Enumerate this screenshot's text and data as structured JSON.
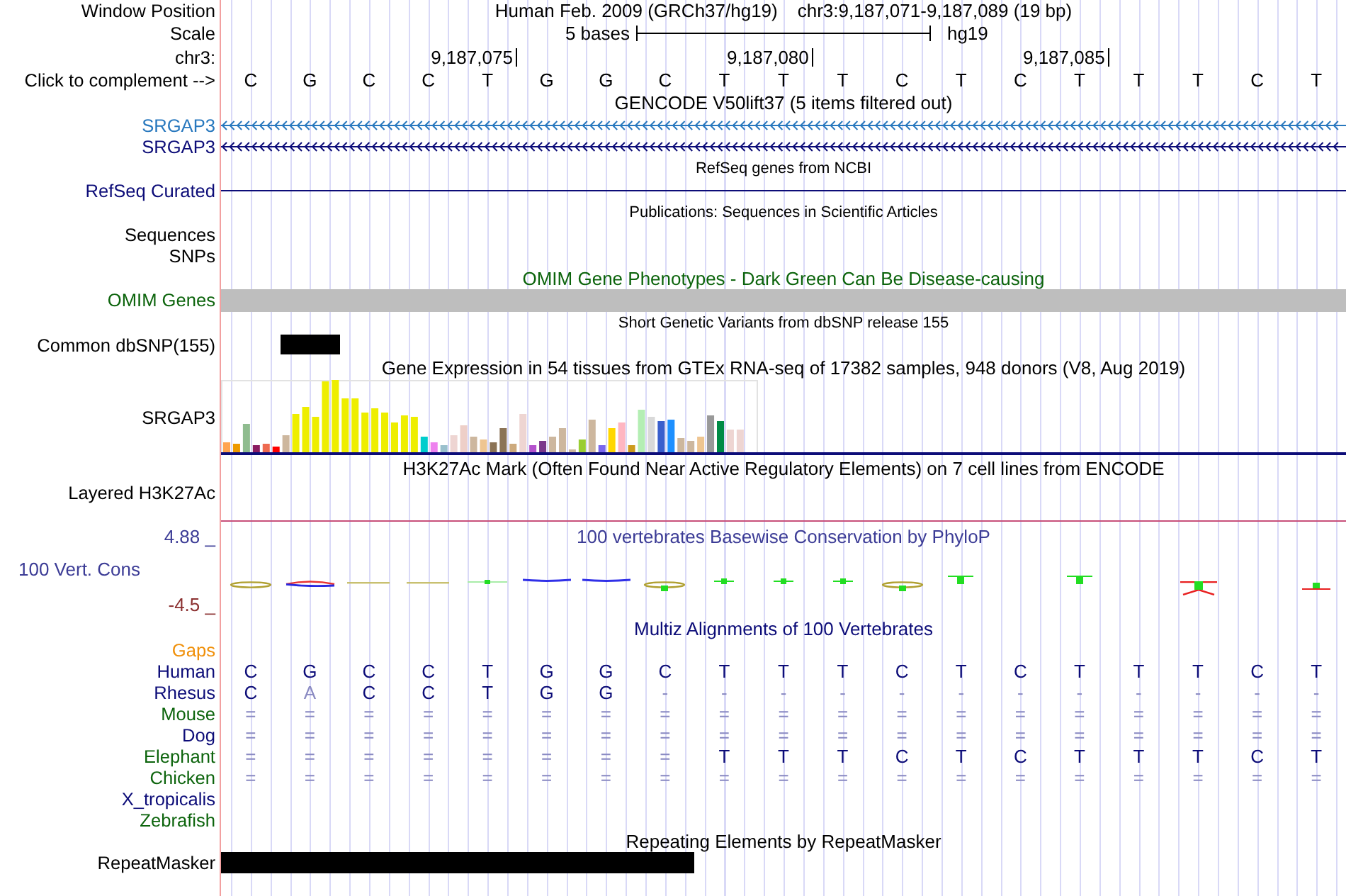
{
  "position": {
    "label": "Window Position",
    "assembly": "Human Feb. 2009 (GRCh37/hg19)",
    "range": "chr3:9,187,071-9,187,089 (19 bp)"
  },
  "scale": {
    "label": "Scale",
    "bar_label": "5 bases",
    "assembly": "hg19"
  },
  "ruler": {
    "label": "chr3:"
  },
  "sequence": {
    "label": "Click to complement -->",
    "bases": [
      {
        "letter": "C"
      },
      {
        "letter": "G"
      },
      {
        "letter": "C"
      },
      {
        "letter": "C"
      },
      {
        "letter": "T",
        "ruler_mark": "9,187,075"
      },
      {
        "letter": "G"
      },
      {
        "letter": "G"
      },
      {
        "letter": "C"
      },
      {
        "letter": "T"
      },
      {
        "letter": "T",
        "ruler_mark": "9,187,080"
      },
      {
        "letter": "T"
      },
      {
        "letter": "C"
      },
      {
        "letter": "T"
      },
      {
        "letter": "C"
      },
      {
        "letter": "T",
        "ruler_mark": "9,187,085"
      },
      {
        "letter": "T"
      },
      {
        "letter": "T"
      },
      {
        "letter": "C"
      },
      {
        "letter": "T"
      }
    ]
  },
  "gencode": {
    "title": "GENCODE V50lift37 (5 items filtered out)",
    "genes": [
      {
        "name": "SRGAP3",
        "color": "#2878be"
      },
      {
        "name": "SRGAP3",
        "color": "#0c0c78"
      }
    ]
  },
  "refseq": {
    "title": "RefSeq genes from NCBI",
    "label": "RefSeq Curated"
  },
  "publications": {
    "title": "Publications: Sequences in Scientific Articles",
    "subtracks": [
      "Sequences",
      "SNPs"
    ]
  },
  "omim": {
    "title": "OMIM Gene Phenotypes - Dark Green Can Be Disease-causing",
    "label": "OMIM Genes"
  },
  "dbsnp": {
    "title": "Short Genetic Variants from dbSNP release 155",
    "label": "Common dbSNP(155)"
  },
  "gtex": {
    "title": "Gene Expression in 54 tissues from GTEx RNA-seq of 17382 samples, 948 donors (V8, Aug 2019)",
    "label": "SRGAP3"
  },
  "h3k27ac": {
    "title": "H3K27Ac Mark (Often Found Near Active Regulatory Elements) on 7 cell lines from ENCODE",
    "label": "Layered H3K27Ac"
  },
  "conservation": {
    "title": "100 vertebrates Basewise Conservation by PhyloP",
    "label": "100 Vert. Cons",
    "scale_max": "4.88 _",
    "scale_min": "-4.5 _"
  },
  "multiz": {
    "title": "Multiz Alignments of 100 Vertebrates",
    "gaps_label": "Gaps",
    "species": [
      {
        "name": "Human",
        "color": "#0c0c78",
        "bases": [
          {
            "letter": "C",
            "dim": false
          },
          {
            "letter": "G",
            "dim": false
          },
          {
            "letter": "C",
            "dim": false
          },
          {
            "letter": "C",
            "dim": false
          },
          {
            "letter": "T",
            "dim": false
          },
          {
            "letter": "G",
            "dim": false
          },
          {
            "letter": "G",
            "dim": false
          },
          {
            "letter": "C",
            "dim": false
          },
          {
            "letter": "T",
            "dim": false
          },
          {
            "letter": "T",
            "dim": false
          },
          {
            "letter": "T",
            "dim": false
          },
          {
            "letter": "C",
            "dim": false
          },
          {
            "letter": "T",
            "dim": false
          },
          {
            "letter": "C",
            "dim": false
          },
          {
            "letter": "T",
            "dim": false
          },
          {
            "letter": "T",
            "dim": false
          },
          {
            "letter": "T",
            "dim": false
          },
          {
            "letter": "C",
            "dim": false
          },
          {
            "letter": "T",
            "dim": false
          }
        ]
      },
      {
        "name": "Rhesus",
        "color": "#0c0c78",
        "bases": [
          {
            "letter": "C",
            "dim": false
          },
          {
            "letter": "A",
            "dim": true
          },
          {
            "letter": "C",
            "dim": false
          },
          {
            "letter": "C",
            "dim": false
          },
          {
            "letter": "T",
            "dim": false
          },
          {
            "letter": "G",
            "dim": false
          },
          {
            "letter": "G",
            "dim": false
          },
          {
            "letter": "-",
            "dim": true
          },
          {
            "letter": "-",
            "dim": true
          },
          {
            "letter": "-",
            "dim": true
          },
          {
            "letter": "-",
            "dim": true
          },
          {
            "letter": "-",
            "dim": true
          },
          {
            "letter": "-",
            "dim": true
          },
          {
            "letter": "-",
            "dim": true
          },
          {
            "letter": "-",
            "dim": true
          },
          {
            "letter": "-",
            "dim": true
          },
          {
            "letter": "-",
            "dim": true
          },
          {
            "letter": "-",
            "dim": true
          },
          {
            "letter": "-",
            "dim": true
          }
        ]
      },
      {
        "name": "Mouse",
        "color": "#0c640c",
        "bases": [
          {
            "letter": "=",
            "dim": true
          },
          {
            "letter": "=",
            "dim": true
          },
          {
            "letter": "=",
            "dim": true
          },
          {
            "letter": "=",
            "dim": true
          },
          {
            "letter": "=",
            "dim": true
          },
          {
            "letter": "=",
            "dim": true
          },
          {
            "letter": "=",
            "dim": true
          },
          {
            "letter": "=",
            "dim": true
          },
          {
            "letter": "=",
            "dim": true
          },
          {
            "letter": "=",
            "dim": true
          },
          {
            "letter": "=",
            "dim": true
          },
          {
            "letter": "=",
            "dim": true
          },
          {
            "letter": "=",
            "dim": true
          },
          {
            "letter": "=",
            "dim": true
          },
          {
            "letter": "=",
            "dim": true
          },
          {
            "letter": "=",
            "dim": true
          },
          {
            "letter": "=",
            "dim": true
          },
          {
            "letter": "=",
            "dim": true
          },
          {
            "letter": "=",
            "dim": true
          }
        ]
      },
      {
        "name": "Dog",
        "color": "#0c0c78",
        "bases": [
          {
            "letter": "=",
            "dim": true
          },
          {
            "letter": "=",
            "dim": true
          },
          {
            "letter": "=",
            "dim": true
          },
          {
            "letter": "=",
            "dim": true
          },
          {
            "letter": "=",
            "dim": true
          },
          {
            "letter": "=",
            "dim": true
          },
          {
            "letter": "=",
            "dim": true
          },
          {
            "letter": "=",
            "dim": true
          },
          {
            "letter": "=",
            "dim": true
          },
          {
            "letter": "=",
            "dim": true
          },
          {
            "letter": "=",
            "dim": true
          },
          {
            "letter": "=",
            "dim": true
          },
          {
            "letter": "=",
            "dim": true
          },
          {
            "letter": "=",
            "dim": true
          },
          {
            "letter": "=",
            "dim": true
          },
          {
            "letter": "=",
            "dim": true
          },
          {
            "letter": "=",
            "dim": true
          },
          {
            "letter": "=",
            "dim": true
          },
          {
            "letter": "=",
            "dim": true
          }
        ]
      },
      {
        "name": "Elephant",
        "color": "#0c640c",
        "bases": [
          {
            "letter": "=",
            "dim": true
          },
          {
            "letter": "=",
            "dim": true
          },
          {
            "letter": "=",
            "dim": true
          },
          {
            "letter": "=",
            "dim": true
          },
          {
            "letter": "=",
            "dim": true
          },
          {
            "letter": "=",
            "dim": true
          },
          {
            "letter": "=",
            "dim": true
          },
          {
            "letter": "=",
            "dim": true
          },
          {
            "letter": "T",
            "dim": false
          },
          {
            "letter": "T",
            "dim": false
          },
          {
            "letter": "T",
            "dim": false
          },
          {
            "letter": "C",
            "dim": false
          },
          {
            "letter": "T",
            "dim": false
          },
          {
            "letter": "C",
            "dim": false
          },
          {
            "letter": "T",
            "dim": false
          },
          {
            "letter": "T",
            "dim": false
          },
          {
            "letter": "T",
            "dim": false
          },
          {
            "letter": "C",
            "dim": false
          },
          {
            "letter": "T",
            "dim": false
          }
        ]
      },
      {
        "name": "Chicken",
        "color": "#0c640c",
        "bases": [
          {
            "letter": "=",
            "dim": true
          },
          {
            "letter": "=",
            "dim": true
          },
          {
            "letter": "=",
            "dim": true
          },
          {
            "letter": "=",
            "dim": true
          },
          {
            "letter": "=",
            "dim": true
          },
          {
            "letter": "=",
            "dim": true
          },
          {
            "letter": "=",
            "dim": true
          },
          {
            "letter": "=",
            "dim": true
          },
          {
            "letter": "=",
            "dim": true
          },
          {
            "letter": "=",
            "dim": true
          },
          {
            "letter": "=",
            "dim": true
          },
          {
            "letter": "=",
            "dim": true
          },
          {
            "letter": "=",
            "dim": true
          },
          {
            "letter": "=",
            "dim": true
          },
          {
            "letter": "=",
            "dim": true
          },
          {
            "letter": "=",
            "dim": true
          },
          {
            "letter": "=",
            "dim": true
          },
          {
            "letter": "=",
            "dim": true
          },
          {
            "letter": "=",
            "dim": true
          }
        ]
      },
      {
        "name": "X_tropicalis",
        "color": "#0c0c78"
      },
      {
        "name": "Zebrafish",
        "color": "#0c640c"
      }
    ]
  },
  "repeatmasker": {
    "title": "Repeating Elements by RepeatMasker",
    "label": "RepeatMasker"
  }
}
